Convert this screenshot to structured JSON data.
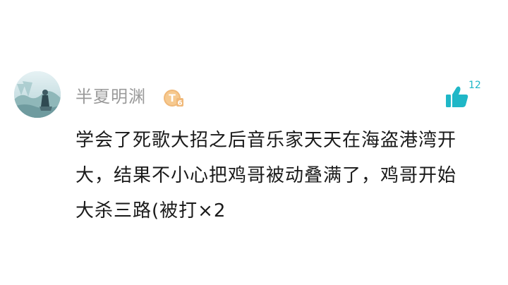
{
  "comment": {
    "username": "半夏明渊",
    "level_badge": {
      "letter": "T",
      "number": "6"
    },
    "like_count": "12",
    "text_lines": [
      "学会了死歌大招之后音乐家天天在海盗港湾开",
      "大，结果不小心把鸡哥被动叠满了，鸡哥开始",
      "大杀三路(被打×2"
    ],
    "icons": {
      "like": "thumbs-up-icon",
      "avatar": "avatar-image"
    },
    "colors": {
      "like_accent": "#1fb7c7",
      "badge": "#f0b878",
      "username": "#9a9a9a"
    }
  }
}
